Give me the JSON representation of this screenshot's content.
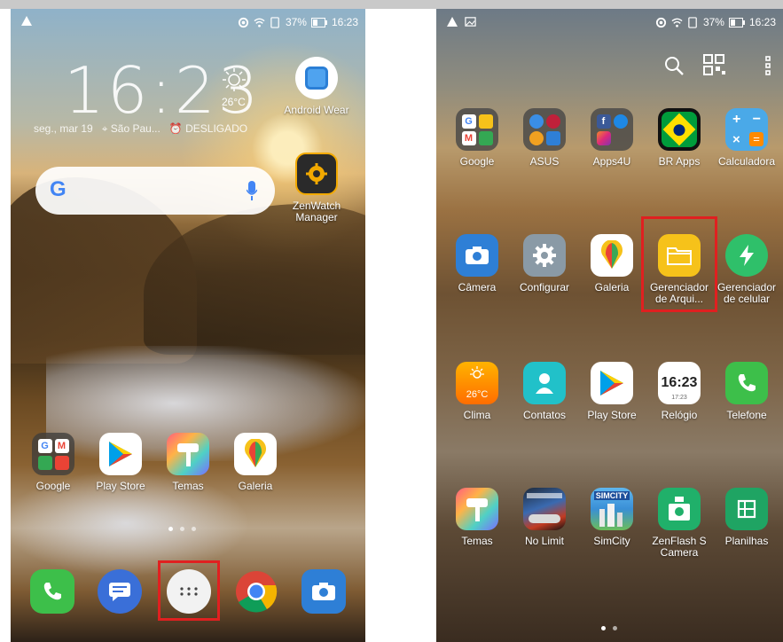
{
  "home": {
    "status": {
      "battery": "37%",
      "time": "16:23"
    },
    "clock": "16:23",
    "weather": {
      "temp": "26°C"
    },
    "date": "seg., mar 19",
    "location": "São Pau...",
    "alarm": "DESLIGADO",
    "widgets": [
      {
        "label": "Android Wear",
        "icon": "android-wear-icon"
      },
      {
        "label": "ZenWatch Manager",
        "icon": "zenwatch-manager-icon"
      }
    ],
    "apps": [
      {
        "label": "Google",
        "icon": "google-folder-icon"
      },
      {
        "label": "Play Store",
        "icon": "play-store-icon"
      },
      {
        "label": "Temas",
        "icon": "temas-icon"
      },
      {
        "label": "Galeria",
        "icon": "galeria-icon"
      }
    ],
    "dock": [
      {
        "label": "Telefone",
        "icon": "phone-icon"
      },
      {
        "label": "Mensagens",
        "icon": "messages-icon"
      },
      {
        "label": "Todos os apps",
        "icon": "app-drawer-icon"
      },
      {
        "label": "Chrome",
        "icon": "chrome-icon"
      },
      {
        "label": "Câmera",
        "icon": "camera-icon"
      }
    ]
  },
  "drawer": {
    "status": {
      "battery": "37%",
      "time": "16:23"
    },
    "rows": [
      [
        {
          "label": "Google",
          "icon": "google-folder-icon"
        },
        {
          "label": "ASUS",
          "icon": "asus-folder-icon"
        },
        {
          "label": "Apps4U",
          "icon": "apps4u-folder-icon"
        },
        {
          "label": "BR Apps",
          "icon": "br-apps-icon"
        },
        {
          "label": "Calculadora",
          "icon": "calculator-icon"
        }
      ],
      [
        {
          "label": "Câmera",
          "icon": "camera-icon"
        },
        {
          "label": "Configurar",
          "icon": "settings-icon"
        },
        {
          "label": "Galeria",
          "icon": "galeria-icon"
        },
        {
          "label": "Gerenciador de Arqui...",
          "icon": "file-manager-icon"
        },
        {
          "label": "Gerenciador de celular",
          "icon": "mobile-manager-icon"
        }
      ],
      [
        {
          "label": "Clima",
          "icon": "weather-icon",
          "badge": "26°C"
        },
        {
          "label": "Contatos",
          "icon": "contacts-icon"
        },
        {
          "label": "Play Store",
          "icon": "play-store-icon"
        },
        {
          "label": "Relógio",
          "icon": "clock-icon",
          "badge": "16:23",
          "sub": "17:23"
        },
        {
          "label": "Telefone",
          "icon": "phone-icon"
        }
      ],
      [
        {
          "label": "Temas",
          "icon": "temas-icon"
        },
        {
          "label": "No Limit",
          "icon": "no-limit-icon"
        },
        {
          "label": "SimCity",
          "icon": "simcity-icon",
          "badge": "SIMCITY"
        },
        {
          "label": "ZenFlash S Camera",
          "icon": "zenflash-icon"
        },
        {
          "label": "Planilhas",
          "icon": "sheets-icon"
        }
      ]
    ]
  },
  "colors": {
    "highlight": "#e02020",
    "accent_yellow": "#f6c21a",
    "play_green": "#01b35c"
  }
}
